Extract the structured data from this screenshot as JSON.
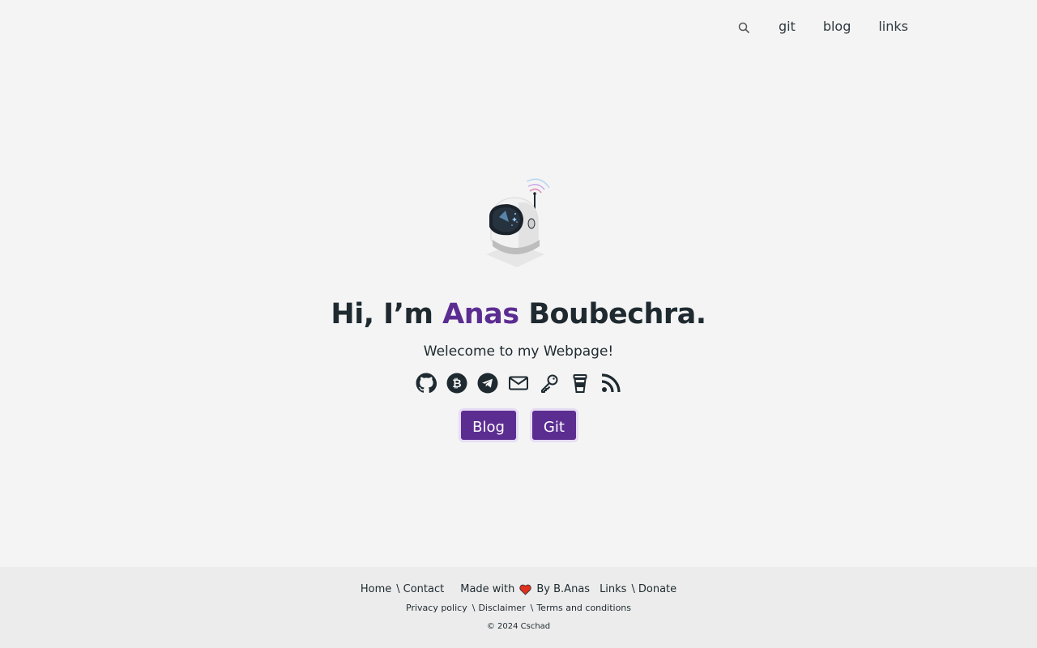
{
  "header": {
    "search_icon": "search-icon",
    "nav": [
      "git",
      "blog",
      "links"
    ]
  },
  "hero": {
    "title_prefix": "Hi, I’m",
    "title_name": "Anas",
    "title_suffix": "Boubechra.",
    "subtitle": "Welecome to my Webpage!",
    "socials": [
      "github-icon",
      "bitcoin-icon",
      "telegram-icon",
      "email-icon",
      "key-icon",
      "coffee-cup-icon",
      "rss-icon"
    ],
    "buttons": [
      "Blog",
      "Git"
    ],
    "accent_color": "#5c2d91"
  },
  "footer": {
    "row1": {
      "home": "Home",
      "contact": "Contact",
      "made_with": "Made with",
      "by": "By B.Anas",
      "links": "Links",
      "donate": "Donate",
      "sep": "\\"
    },
    "row2": {
      "privacy": "Privacy policy",
      "disclaimer": "Disclaimer",
      "terms": "Terms and conditions"
    },
    "copyright": "© 2024 Cschad"
  }
}
